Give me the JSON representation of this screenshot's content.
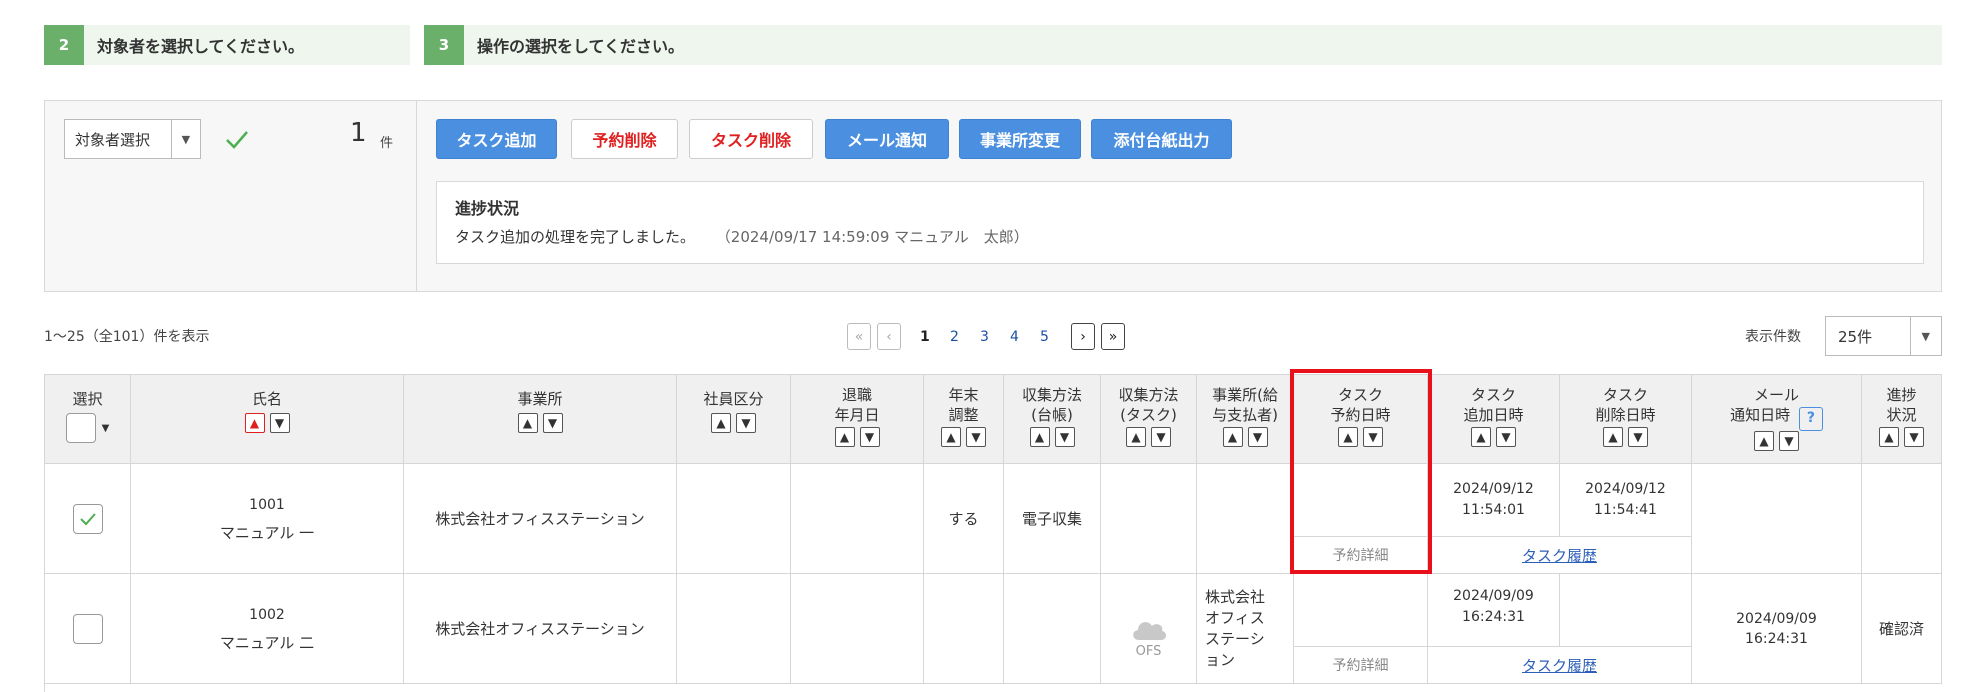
{
  "steps": [
    {
      "num": "2",
      "text": "対象者を選択してください。"
    },
    {
      "num": "3",
      "text": "操作の選択をしてください。"
    }
  ],
  "target": {
    "select_label": "対象者選択",
    "count": "1",
    "count_unit": "件"
  },
  "actions": {
    "task_add": "タスク追加",
    "reserve_delete": "予約削除",
    "task_delete": "タスク削除",
    "mail_notify": "メール通知",
    "office_change": "事業所変更",
    "ledger_output": "添付台紙出力"
  },
  "progress": {
    "title": "進捗状況",
    "message": "タスク追加の処理を完了しました。",
    "meta": "（2024/09/17 14:59:09 マニュアル　太郎）"
  },
  "list_info": "1～25（全101）件を表示",
  "pagination": {
    "first": "«",
    "prev": "‹",
    "pages": [
      "1",
      "2",
      "3",
      "4",
      "5"
    ],
    "next": "›",
    "last": "»"
  },
  "page_size": {
    "label": "表示件数",
    "value": "25件"
  },
  "columns": {
    "select": "選択",
    "name": "氏名",
    "office": "事業所",
    "emp_type": "社員区分",
    "retire_date_1": "退職",
    "retire_date_2": "年月日",
    "yearend_1": "年末",
    "yearend_2": "調整",
    "collect_ledger_1": "収集方法",
    "collect_ledger_2": "(台帳)",
    "collect_task_1": "収集方法",
    "collect_task_2": "(タスク)",
    "payer_1": "事業所(給",
    "payer_2": "与支払者)",
    "reserve_1": "タスク",
    "reserve_2": "予約日時",
    "added_1": "タスク",
    "added_2": "追加日時",
    "deleted_1": "タスク",
    "deleted_2": "削除日時",
    "mail_1": "メール",
    "mail_2": "通知日時",
    "status_1": "進捗",
    "status_2": "状況"
  },
  "sort_up": "▲",
  "sort_down": "▼",
  "rows": [
    {
      "checked": true,
      "id": "1001",
      "name": "マニュアル 一",
      "office": "株式会社オフィスステーション",
      "yearend": "する",
      "collect_ledger": "電子収集",
      "reserve_detail": "予約詳細",
      "added_date": "2024/09/12",
      "added_time": "11:54:01",
      "deleted_date": "2024/09/12",
      "deleted_time": "11:54:41",
      "history": "タスク履歴"
    },
    {
      "checked": false,
      "id": "1002",
      "name": "マニュアル 二",
      "office": "株式会社オフィスステーション",
      "collect_task": "OFS",
      "payer": "株式会社オフィスステーション",
      "reserve_detail": "予約詳細",
      "added_date": "2024/09/09",
      "added_time": "16:24:31",
      "history": "タスク履歴",
      "mail_date": "2024/09/09",
      "mail_time": "16:24:31",
      "status": "確認済"
    }
  ],
  "colors": {
    "accent_blue": "#4a8fe0",
    "danger_red": "#e02020",
    "step_green": "#6ab06a",
    "highlight": "#e8101a"
  }
}
